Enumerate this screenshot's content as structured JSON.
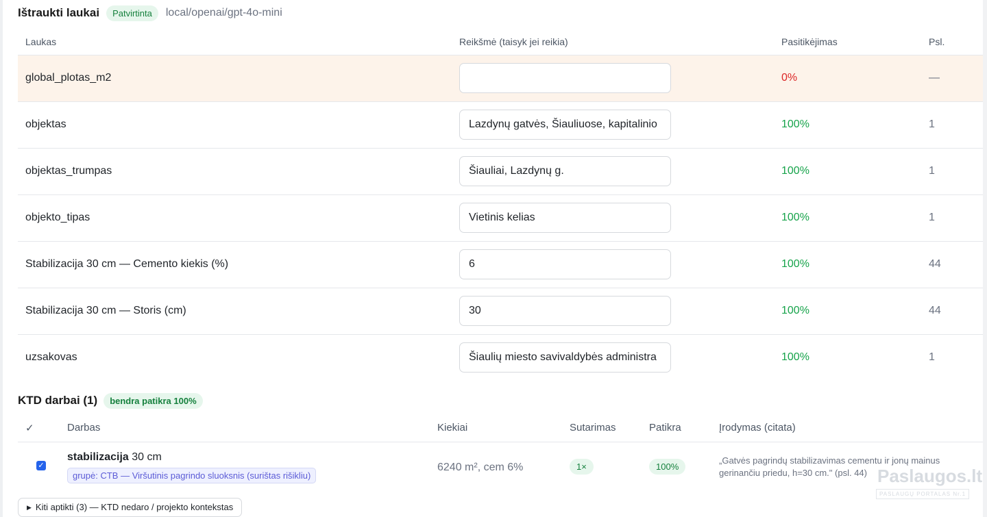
{
  "header": {
    "title": "Ištraukti laukai",
    "status": "Patvirtinta",
    "model": "local/openai/gpt-4o-mini"
  },
  "fields_table": {
    "columns": [
      "Laukas",
      "Reikšmė (taisyk jei reikia)",
      "Pasitikėjimas",
      "Psl."
    ],
    "rows": [
      {
        "name": "global_plotas_m2",
        "value": "",
        "confidence": "0%",
        "page": "—",
        "status": "bad"
      },
      {
        "name": "objektas",
        "value": "Lazdynų gatvės, Šiauliuose, kapitalinio",
        "confidence": "100%",
        "page": "1",
        "status": "ok"
      },
      {
        "name": "objektas_trumpas",
        "value": "Šiauliai, Lazdynų g.",
        "confidence": "100%",
        "page": "1",
        "status": "ok"
      },
      {
        "name": "objekto_tipas",
        "value": "Vietinis kelias",
        "confidence": "100%",
        "page": "1",
        "status": "ok"
      },
      {
        "name": "Stabilizacija 30 cm — Cemento kiekis (%)",
        "value": "6",
        "confidence": "100%",
        "page": "44",
        "status": "ok"
      },
      {
        "name": "Stabilizacija 30 cm — Storis (cm)",
        "value": "30",
        "confidence": "100%",
        "page": "44",
        "status": "ok"
      },
      {
        "name": "uzsakovas",
        "value": "Šiaulių miesto savivaldybės administra",
        "confidence": "100%",
        "page": "1",
        "status": "ok"
      }
    ]
  },
  "ktd": {
    "title": "KTD darbai (1)",
    "badge": "bendra patikra 100%",
    "columns": [
      "✓",
      "Darbas",
      "Kiekiai",
      "Sutarimas",
      "Patikra",
      "Įrodymas (citata)"
    ],
    "rows": [
      {
        "checked": true,
        "work_name": "stabilizacija",
        "work_detail": " 30 cm",
        "group": "grupė: CTB — Viršutinis pagrindo sluoksnis (surištas rišikliu)",
        "quantities": "6240 m², cem 6%",
        "agreement": "1×",
        "check": "100%",
        "evidence": "„Gatvės pagrindų stabilizavimas cementu ir jonų mainus gerinančiu priedu, h=30 cm.\" (psl. 44)"
      }
    ]
  },
  "other_button": {
    "label": "Kiti aptikti (3) — KTD nedaro / projekto kontekstas"
  },
  "watermark": {
    "main": "Paslaugos.lt",
    "sub": "PASLAUGŲ PORTALAS Nr.1"
  },
  "colors": {
    "ok": "#16a34a",
    "bad": "#dc2626",
    "warn_row": "#fdf3ea",
    "badge_bg": "#e6f6ec",
    "accent": "#2563eb"
  }
}
